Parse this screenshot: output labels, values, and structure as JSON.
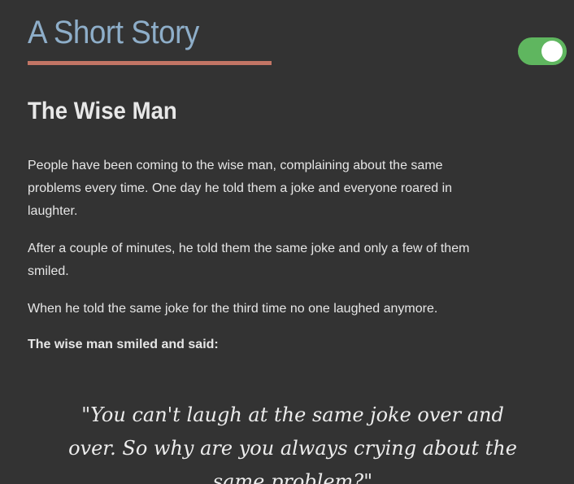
{
  "header": {
    "site_title": "A Short Story",
    "accent_color": "#c27565",
    "title_color": "#8eaec9"
  },
  "theme_toggle": {
    "state": "on",
    "color": "#5fb65f"
  },
  "story": {
    "title": "The Wise Man",
    "paragraphs": [
      "People have been coming to the wise man, complaining about the same problems every time. One day he told them a joke and everyone roared in laughter.",
      "After a couple of minutes, he told them the same joke and only a few of them smiled.",
      "When he told the same joke for the third time no one laughed anymore."
    ],
    "lead_in": "The wise man smiled and said:",
    "quote": "\"You can't laugh at the same joke over and over. So why are you always crying about the same problem?\""
  }
}
